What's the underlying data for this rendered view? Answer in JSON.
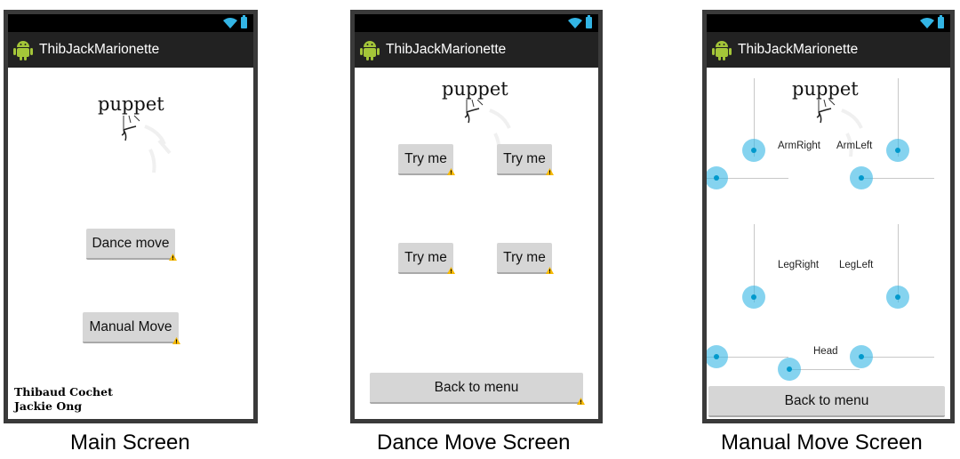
{
  "app_title": "ThibJackMarionette",
  "logo_word": "puppet",
  "colors": {
    "accent": "#33b5e5",
    "actionbar": "#222222",
    "button": "#d6d6d6",
    "warning": "#f5b800"
  },
  "main_screen": {
    "dance_button": "Dance move",
    "manual_button": "Manual Move",
    "credits": [
      "Thibaud Cochet",
      "Jackie Ong"
    ],
    "caption": "Main Screen"
  },
  "dance_screen": {
    "try_buttons": [
      "Try me",
      "Try me",
      "Try me",
      "Try me"
    ],
    "back_button": "Back to menu",
    "caption": "Dance Move Screen"
  },
  "manual_screen": {
    "labels": {
      "arm_right": "ArmRight",
      "arm_left": "ArmLeft",
      "leg_right": "LegRight",
      "leg_left": "LegLeft",
      "head": "Head"
    },
    "back_button": "Back to menu",
    "caption": "Manual Move Screen"
  }
}
